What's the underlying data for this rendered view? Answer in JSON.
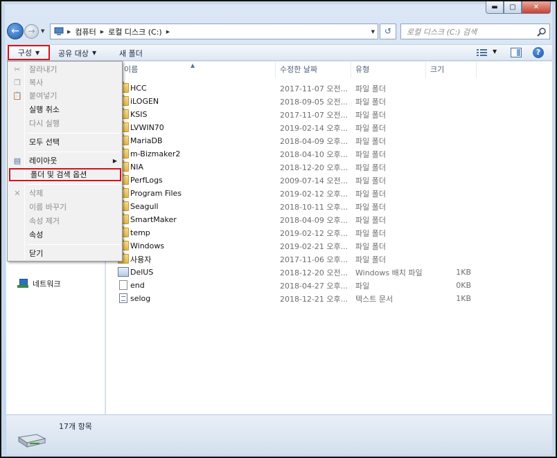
{
  "window": {
    "minimize_glyph": "▬",
    "maximize_glyph": "▢",
    "close_glyph": "✕"
  },
  "address": {
    "crumbs": [
      "컴퓨터",
      "로컬 디스크 (C:)"
    ],
    "search_placeholder": "로컬 디스크 (C:) 검색"
  },
  "toolbar": {
    "organize_label": "구성",
    "share_label": "공유 대상",
    "newfolder_label": "새 폴더"
  },
  "columns": {
    "name": "이름",
    "date": "수정한 날짜",
    "type": "유형",
    "size": "크기"
  },
  "files": [
    {
      "name": "HCC",
      "date": "2017-11-07 오전...",
      "type": "파일 폴더",
      "size": "",
      "kind": "folder"
    },
    {
      "name": "iLOGEN",
      "date": "2018-09-05 오전...",
      "type": "파일 폴더",
      "size": "",
      "kind": "folder"
    },
    {
      "name": "KSIS",
      "date": "2017-11-07 오전...",
      "type": "파일 폴더",
      "size": "",
      "kind": "folder"
    },
    {
      "name": "LVWIN70",
      "date": "2019-02-14 오후...",
      "type": "파일 폴더",
      "size": "",
      "kind": "folder"
    },
    {
      "name": "MariaDB",
      "date": "2018-04-09 오후...",
      "type": "파일 폴더",
      "size": "",
      "kind": "folder"
    },
    {
      "name": "m-Bizmaker2",
      "date": "2018-04-10 오후...",
      "type": "파일 폴더",
      "size": "",
      "kind": "folder"
    },
    {
      "name": "NIA",
      "date": "2018-12-20 오후...",
      "type": "파일 폴더",
      "size": "",
      "kind": "folder"
    },
    {
      "name": "PerfLogs",
      "date": "2009-07-14 오전...",
      "type": "파일 폴더",
      "size": "",
      "kind": "folder"
    },
    {
      "name": "Program Files",
      "date": "2019-02-12 오후...",
      "type": "파일 폴더",
      "size": "",
      "kind": "folder"
    },
    {
      "name": "Seagull",
      "date": "2018-10-11 오후...",
      "type": "파일 폴더",
      "size": "",
      "kind": "folder"
    },
    {
      "name": "SmartMaker",
      "date": "2018-04-09 오후...",
      "type": "파일 폴더",
      "size": "",
      "kind": "folder"
    },
    {
      "name": "temp",
      "date": "2019-02-12 오후...",
      "type": "파일 폴더",
      "size": "",
      "kind": "folder"
    },
    {
      "name": "Windows",
      "date": "2019-02-21 오후...",
      "type": "파일 폴더",
      "size": "",
      "kind": "folder"
    },
    {
      "name": "사용자",
      "date": "2017-11-06 오후...",
      "type": "파일 폴더",
      "size": "",
      "kind": "folder"
    },
    {
      "name": "DelUS",
      "date": "2018-12-20 오전...",
      "type": "Windows 배치 파일",
      "size": "1KB",
      "kind": "bat"
    },
    {
      "name": "end",
      "date": "2018-04-27 오후...",
      "type": "파일",
      "size": "0KB",
      "kind": "file"
    },
    {
      "name": "selog",
      "date": "2018-12-21 오후...",
      "type": "텍스트 문서",
      "size": "1KB",
      "kind": "txt"
    }
  ],
  "menu": {
    "cut": "잘라내기",
    "copy": "복사",
    "paste": "붙여넣기",
    "undo": "실행 취소",
    "redo": "다시 실행",
    "select_all": "모두 선택",
    "layout": "레이아웃",
    "folder_options": "폴더 및 검색 옵션",
    "delete": "삭제",
    "rename": "이름 바꾸기",
    "remove_props": "속성 제거",
    "properties": "속성",
    "close": "닫기"
  },
  "nav": {
    "network": "네트워크"
  },
  "status": {
    "item_count": "17개 항목"
  },
  "colors": {
    "highlight_border": "#d4131c",
    "accent": "#1f5fb0"
  }
}
